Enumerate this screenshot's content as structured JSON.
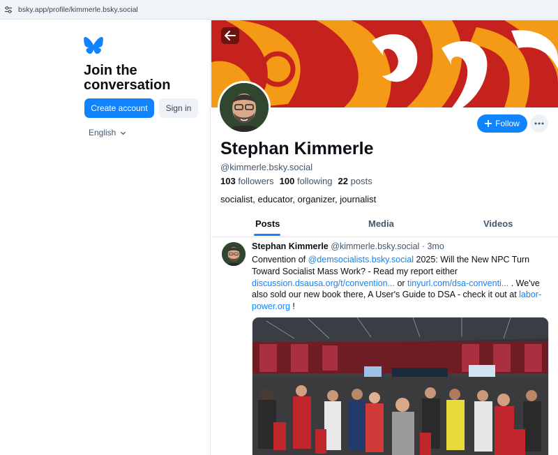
{
  "browser": {
    "url": "bsky.app/profile/kimmerle.bsky.social"
  },
  "sidebar": {
    "logo": "bluesky-butterfly-icon",
    "heading_line1": "Join the",
    "heading_line2": "conversation",
    "create_account": "Create account",
    "sign_in": "Sign in",
    "language": "English"
  },
  "profile": {
    "name": "Stephan Kimmerle",
    "handle": "@kimmerle.bsky.social",
    "followers_count": "103",
    "followers_label": "followers",
    "following_count": "100",
    "following_label": "following",
    "posts_count": "22",
    "posts_label": "posts",
    "bio": "socialist, educator, organizer, journalist",
    "follow_label": "Follow"
  },
  "tabs": [
    {
      "label": "Posts",
      "active": true
    },
    {
      "label": "Media",
      "active": false
    },
    {
      "label": "Videos",
      "active": false
    }
  ],
  "post": {
    "author": "Stephan Kimmerle",
    "handle": "@kimmerle.bsky.social",
    "age": "· 3mo",
    "text_1": "Convention of ",
    "mention": "@demsocialists.bsky.social",
    "text_2": " 2025: Will the New NPC Turn Toward Socialist Mass Work? - Read my report either ",
    "link_1": "discussion.dsausa.org/t/convention...",
    "text_3": " or ",
    "link_2": "tinyurl.com/dsa-conventi...",
    "text_4": " . We've also sold our new book there, A User's Guide to DSA - check it out at ",
    "link_3": "labor-power.org",
    "text_5": " !"
  },
  "colors": {
    "accent": "#1083fe",
    "banner_red": "#c5211d",
    "banner_orange": "#f59a17"
  }
}
